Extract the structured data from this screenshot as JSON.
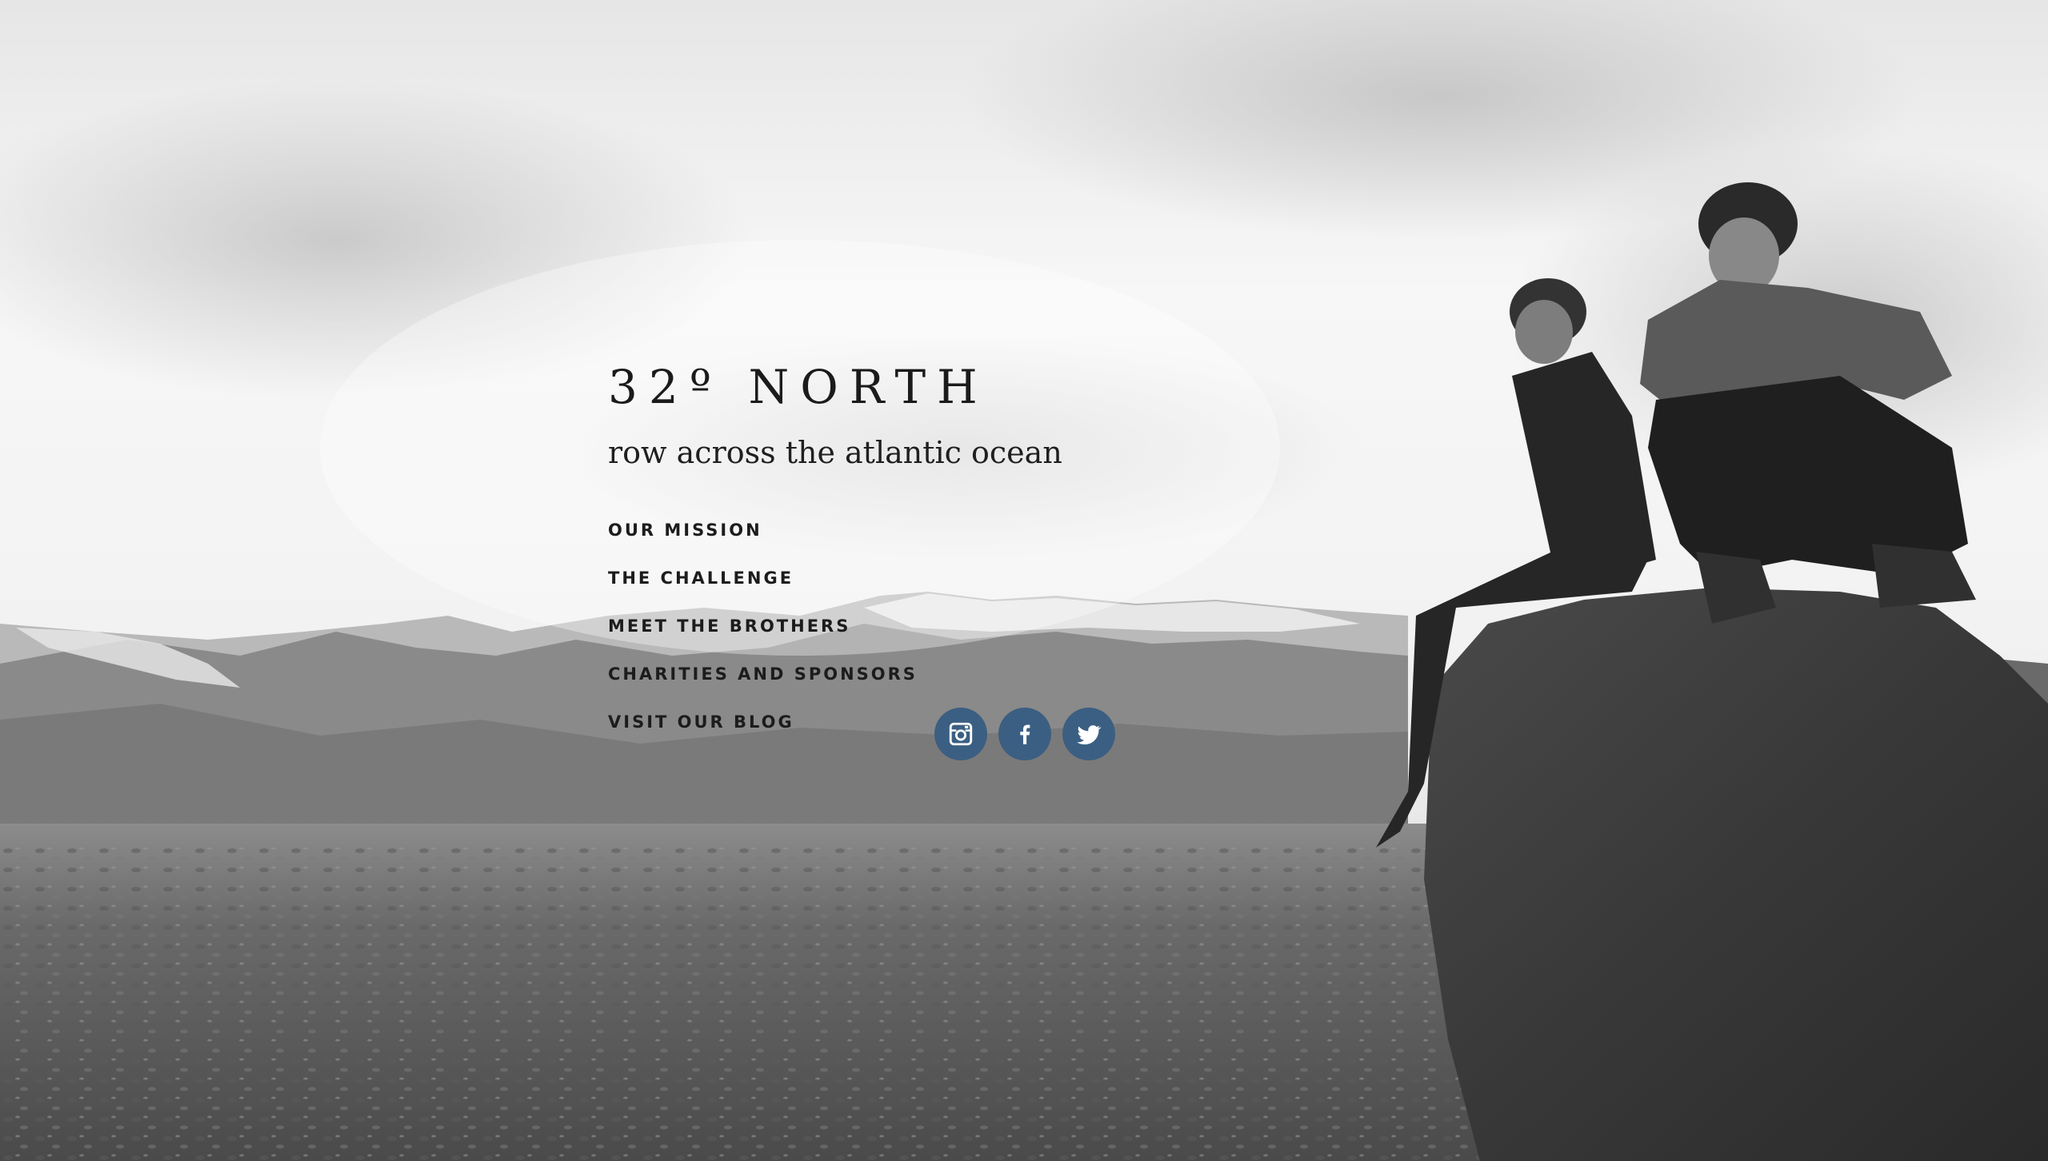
{
  "site": {
    "title": "32º NORTH",
    "tagline": "row across the atlantic ocean"
  },
  "nav": {
    "items": [
      {
        "label": "OUR MISSION"
      },
      {
        "label": "THE CHALLENGE"
      },
      {
        "label": "MEET THE BROTHERS"
      },
      {
        "label": "CHARITIES AND SPONSORS"
      },
      {
        "label": "VISIT OUR BLOG"
      }
    ]
  },
  "social": {
    "items": [
      {
        "icon": "instagram-icon"
      },
      {
        "icon": "facebook-icon"
      },
      {
        "icon": "twitter-icon"
      }
    ],
    "button_color": "#3b5f82"
  }
}
